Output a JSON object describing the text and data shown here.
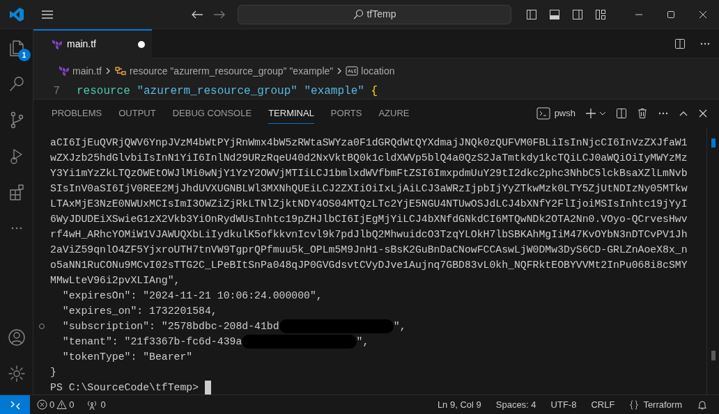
{
  "title_bar": {
    "search": "tfTemp"
  },
  "activity_bar": {
    "items": [
      {
        "kind": "explorer",
        "badge": "1"
      },
      {
        "kind": "search"
      },
      {
        "kind": "source-control"
      },
      {
        "kind": "run-debug"
      },
      {
        "kind": "extensions"
      },
      {
        "kind": "more"
      }
    ],
    "bottom_items": [
      {
        "kind": "account"
      },
      {
        "kind": "settings"
      }
    ]
  },
  "editor": {
    "tabs": [
      {
        "label": "main.tf",
        "selected": true,
        "dirty": true
      }
    ],
    "breadcrumb": [
      {
        "kind": "file",
        "label": "main.tf"
      },
      {
        "kind": "resource",
        "label": "resource \"azurerm_resource_group\" \"example\""
      },
      {
        "kind": "property",
        "label": "location"
      }
    ],
    "code_lines": [
      {
        "number": "7",
        "tokens": [
          {
            "kind": "keyword",
            "text": "resource"
          },
          {
            "kind": "string",
            "text": "\"azurerm_resource_group\""
          },
          {
            "kind": "string",
            "text": "\"example\""
          },
          {
            "kind": "brace",
            "text": "{"
          }
        ]
      }
    ]
  },
  "panel": {
    "tabs": [
      {
        "label": "PROBLEMS",
        "selected": false
      },
      {
        "label": "OUTPUT",
        "selected": false
      },
      {
        "label": "DEBUG CONSOLE",
        "selected": false
      },
      {
        "label": "TERMINAL",
        "selected": true
      },
      {
        "label": "PORTS",
        "selected": false
      },
      {
        "label": "AZURE",
        "selected": false
      }
    ],
    "terminal_profile": "pwsh",
    "terminal_lines": [
      {
        "text": "aCI6IjEuQVRjQWV6YnpJVzM4bWtPYjRnWmx4bW5zRWtaSWYza0F1dGRQdWtQYXdmajJNQk0zQUFVM0FBLiIsInNjcCI6InVzZXJfaW1"
      },
      {
        "text": "wZXJzb25hdGlvbiIsInN1YiI6InlNd29URzRqeU40d2NxVktBQ0k1cldXWVp5blQ4a0QzS2JaTmtkdy1kcTQiLCJ0aWQiOiIyMWYzMz"
      },
      {
        "text": "Y3Yi1mYzZkLTQzOWEtOWJlMi0wNjY1YzY2OWVjMTIiLCJ1bmlxdWVfbmFtZSI6ImxpdmUuY29tI2dkc2phc3NhbC5lckBsaXZlLmNvb"
      },
      {
        "text": "SIsInV0aSI6IjV0REE2MjJhdUVXUGNBLWl3MXNhQUEiLCJ2ZXIiOiIxLjAiLCJ3aWRzIjpbIjYyZTkwMzk0LTY5ZjUtNDIzNy05MTkw"
      },
      {
        "text": "LTAxMjE3NzE0NWUxMCIsImI3OWZiZjRkLTNlZjktNDY4OS04MTQzLTc2YjE5NGU4NTUwOSJdLCJ4bXNfY2FlIjoiMSIsInhtc19jYyI"
      },
      {
        "text": "6WyJDUDEiXSwieG1zX2Vkb3YiOnRydWUsInhtc19pZHJlbCI6IjEgMjYiLCJ4bXNfdGNkdCI6MTQwNDk2OTA2Nn0.VOyo-QCrvesHwv"
      },
      {
        "text": "rf4wH_ARhcYOMiW1VJAWUQXbLiIydkulK5ofkkvnIcvl9k7pdJlbQ2MhwuidcO3TzqYLOkH7lbSBKAhMgIiM47KvOYbN3nDTCvPV1Jh"
      },
      {
        "text": "2aViZ59qnlO4ZF5YjxroUTH7tnVW9TgprQPfmuu5k_OPLm5M9JnH1-sBsK2GuBnDaCNowFCCAswLjW0DMw3DyS6CD-GRLZnAoeX8x_n"
      },
      {
        "text": "o5aNN1RuCONu9MCvI02sTTG2C_LPeBItSnPa048qJP0GVGdsvtCVyDJve1Aujnq7GBD83vL0kh_NQFRktEOBYVVMt2InPu068i8cSMY"
      },
      {
        "text": "MMwLteV96i2pvXLIAng\","
      },
      {
        "text": "  \"expiresOn\": \"2024-11-21 10:06:24.000000\","
      },
      {
        "text": "  \"expires_on\": 1732201584,"
      },
      {
        "text": "  \"subscription\": \"2578bdbc-208d-41bd",
        "redacted": true,
        "rest": "\",",
        "decoration": true
      },
      {
        "text": "  \"tenant\": \"21f3367b-fc6d-439a",
        "redacted": true,
        "rest": "\","
      },
      {
        "text": "  \"tokenType\": \"Bearer\""
      },
      {
        "text": "}"
      },
      {
        "text": "PS C:\\SourceCode\\tfTemp> ",
        "cursor": true
      }
    ]
  },
  "status_bar": {
    "errors": "0",
    "warnings": "0",
    "ports": "0",
    "items": [
      "Ln 9, Col 9",
      "Spaces: 4",
      "UTF-8",
      "CRLF"
    ],
    "language": "Terraform"
  }
}
